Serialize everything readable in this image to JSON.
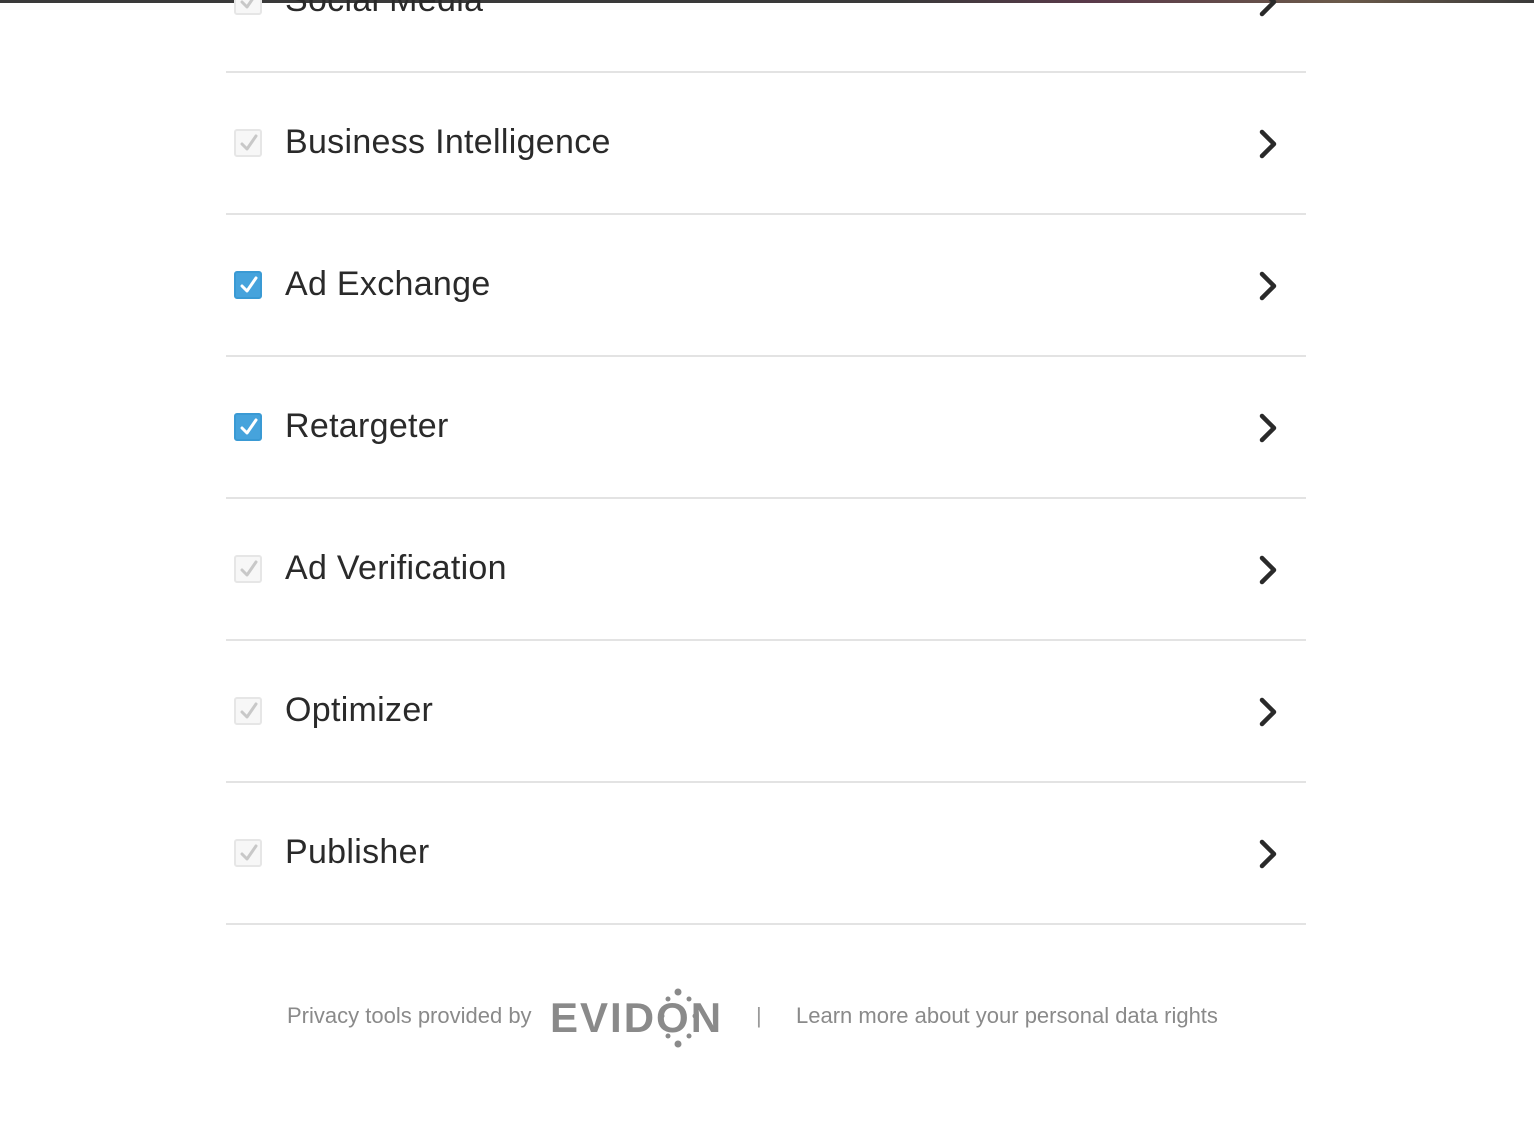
{
  "categories": [
    {
      "label": "Social Media",
      "checked": false
    },
    {
      "label": "Business Intelligence",
      "checked": false
    },
    {
      "label": "Ad Exchange",
      "checked": true
    },
    {
      "label": "Retargeter",
      "checked": true
    },
    {
      "label": "Ad Verification",
      "checked": false
    },
    {
      "label": "Optimizer",
      "checked": false
    },
    {
      "label": "Publisher",
      "checked": false
    }
  ],
  "footer": {
    "provided_by": "Privacy tools provided by",
    "logo_text": "EVIDON",
    "separator": "|",
    "learn_more": "Learn more about your personal data rights"
  },
  "colors": {
    "checked": "#46a3dc",
    "unchecked": "#f7f7f7",
    "text": "#2a2a2a",
    "footer_text": "#8a8a8a"
  }
}
